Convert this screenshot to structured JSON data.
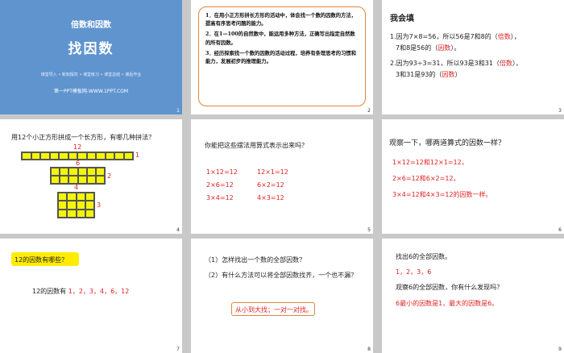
{
  "slides": [
    {
      "number": "1",
      "kicker": "倍数和因数",
      "title": "找因数",
      "sections": "课堂导入 • 新知探究 • 课堂练习 • 课堂总结 • 课后作业",
      "site": "第一PPT模板网-WWW.1PPT.COM",
      "bg_color": "#5f94cf"
    },
    {
      "number": "2",
      "goals": [
        "1．在用小正方形拼长方形的活动中，体会找一个数的因数的方法，提高有序思考问题的能力。",
        "2．在1—100的自然数中，能运用多种方法，正确写出指定自然数的所有因数。",
        "3．经历探索找一个数的因数的活动过程，培养有条理思考的习惯和能力，发展初步的推理能力。"
      ]
    },
    {
      "number": "3",
      "heading": "我会填",
      "line1_a": "1.因为7×8=56，所以56是7和8的（",
      "line1_ans1": "倍数",
      "line1_b": "），",
      "line2_a": "7和8是56的（",
      "line2_ans": "因数",
      "line2_b": "）。",
      "line3_a": "2.因为93÷3=31，所以93是3和31（",
      "line3_ans1": "倍数",
      "line3_b": "），",
      "line4_a": "3和31是93的（",
      "line4_ans": "因数",
      "line4_b": "）"
    },
    {
      "number": "4",
      "question": "用12个小正方形拼成一个长方形，有哪几种拼法？",
      "labels": {
        "r1_top": "12",
        "r1_side": "1",
        "r2_top": "6",
        "r2_side": "2",
        "r3_top": "4",
        "r3_side": "3"
      }
    },
    {
      "number": "5",
      "question": "你能把这些摆法用算式表示出来吗？",
      "left": [
        "1×12=12",
        "2×6=12",
        "3×4=12"
      ],
      "right": [
        "12×1=12",
        "6×2=12",
        "4×3=12"
      ]
    },
    {
      "number": "6",
      "question": "观察一下，哪两道算式的因数一样？",
      "lines": [
        "1×12=12和12×1=12，",
        "2×6=12和6×2=12，",
        "3×4=12和4×3=12的因数一样。"
      ]
    },
    {
      "number": "7",
      "badge": "12的因数有哪些？",
      "answer_prefix": "12的因数有",
      "answer_values": "1，2，3，4，6，12"
    },
    {
      "number": "8",
      "q1": "（1）怎样找出一个数的全部因数？",
      "q2": "（2）有什么方法可以将全部因数找齐，一个也不漏？",
      "answer": "从小到大找；一对一对找。"
    },
    {
      "number": "9",
      "line1": "找出6的全部因数。",
      "line2": "1，2，3，6",
      "line3": "观察6的全部因数，你有什么发现吗？",
      "line4": "6最小的因数是1，最大的因数是6。"
    }
  ]
}
